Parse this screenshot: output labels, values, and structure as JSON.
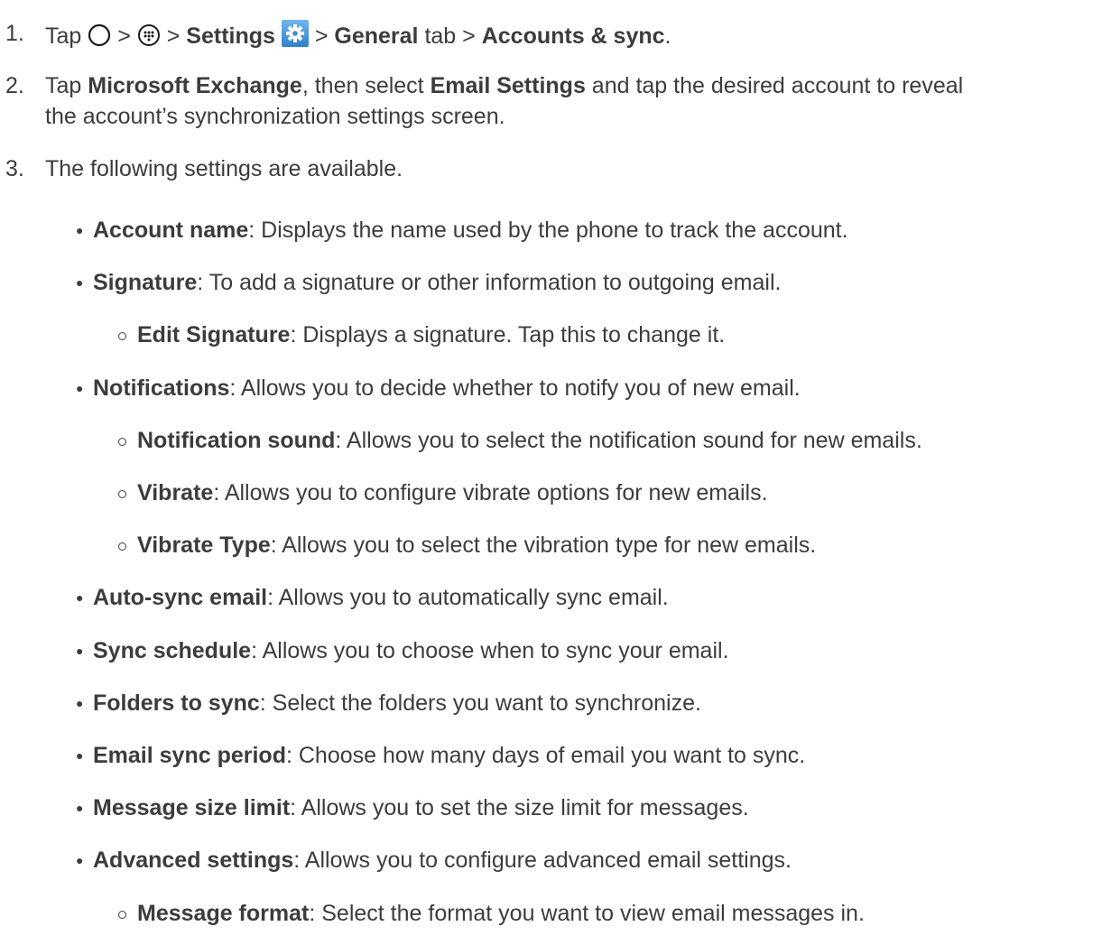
{
  "steps": [
    {
      "num": "1.",
      "parts": {
        "tap": "Tap",
        "sep1": ">",
        "sep2": ">",
        "settings": "Settings",
        "sep3": ">",
        "general": "General",
        "tab_word": " tab >",
        "accounts_sync": "Accounts & sync",
        "end": "."
      },
      "icons": [
        "home-circle-icon",
        "apps-grid-icon",
        "settings-gear-icon"
      ]
    },
    {
      "num": "2.",
      "line1_pre": "Tap ",
      "line1_b1": "Microsoft Exchange",
      "line1_mid": ", then select ",
      "line1_b2": "Email Settings",
      "line1_post": " and tap the desired account to reveal",
      "line2": "the account’s synchronization settings screen."
    },
    {
      "num": "3.",
      "text": "The following settings are available."
    }
  ],
  "settings_list": [
    {
      "level": 1,
      "term": "Account name",
      "desc": ": Displays the name used by the phone to track the account."
    },
    {
      "level": 1,
      "term": "Signature",
      "desc": ": To add a signature or other information to outgoing email."
    },
    {
      "level": 2,
      "term": "Edit Signature",
      "desc": ": Displays a signature. Tap this to change it."
    },
    {
      "level": 1,
      "term": "Notifications",
      "desc": ": Allows you to decide whether to notify you of new email."
    },
    {
      "level": 2,
      "term": "Notification sound",
      "desc": ": Allows you to select the notification sound for new emails."
    },
    {
      "level": 2,
      "term": "Vibrate",
      "desc": ": Allows you to configure vibrate options for new emails."
    },
    {
      "level": 2,
      "term": "Vibrate Type",
      "desc": ": Allows you to select the vibration type for new emails."
    },
    {
      "level": 1,
      "term": "Auto-sync email",
      "desc": ": Allows you to automatically sync email."
    },
    {
      "level": 1,
      "term": "Sync schedule",
      "desc": ": Allows you to choose when to sync your email."
    },
    {
      "level": 1,
      "term": "Folders to sync",
      "desc": ": Select the folders you want to synchronize."
    },
    {
      "level": 1,
      "term": "Email sync period",
      "desc": ": Choose how many days of email you want to sync."
    },
    {
      "level": 1,
      "term": "Message size limit",
      "desc": ": Allows you to set the size limit for messages."
    },
    {
      "level": 1,
      "term": "Advanced settings",
      "desc": ": Allows you to configure advanced email settings."
    },
    {
      "level": 2,
      "term": "Message format",
      "desc": ": Select the format you want to view email messages in."
    }
  ],
  "colors": {
    "text": "#3c3c3c",
    "settings_icon_bg": "#3d8fd6"
  }
}
